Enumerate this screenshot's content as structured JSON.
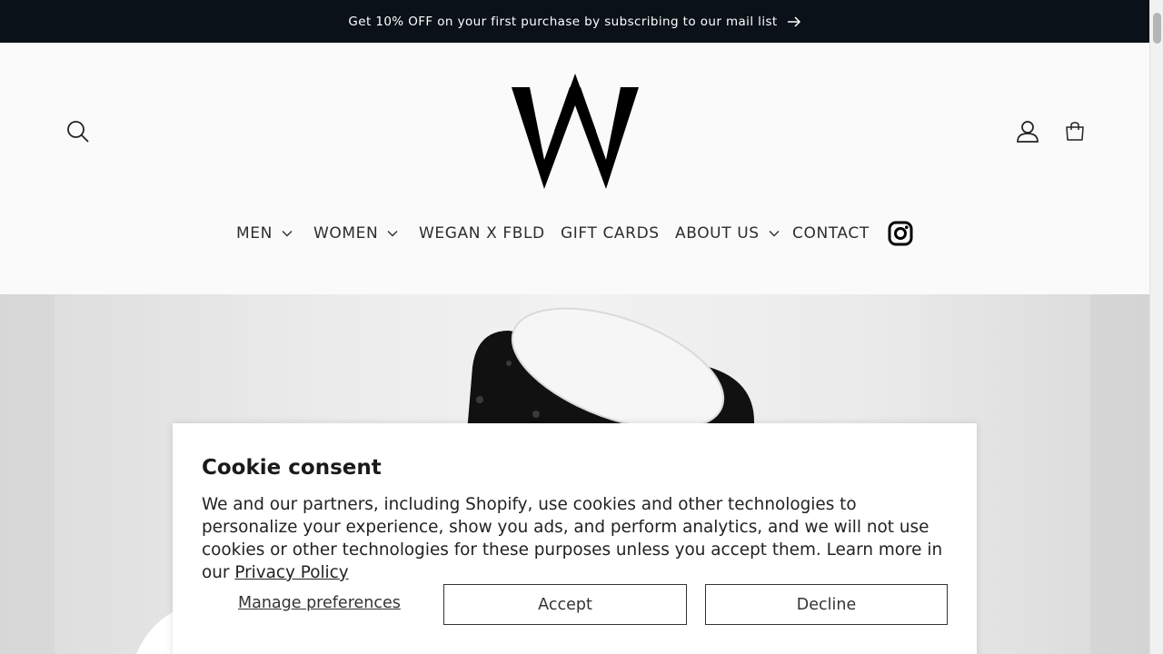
{
  "announcement": {
    "text": "Get 10% OFF on your first purchase by subscribing to our mail list"
  },
  "nav": {
    "items": [
      {
        "label": "MEN"
      },
      {
        "label": "WOMEN"
      },
      {
        "label": "WEGAN X FBLD"
      },
      {
        "label": "GIFT CARDS"
      },
      {
        "label": "ABOUT US"
      },
      {
        "label": "CONTACT"
      }
    ]
  },
  "icons": {
    "search": "search-icon",
    "account": "account-icon",
    "cart": "cart-icon",
    "instagram": "instagram-icon",
    "logo": "w-logo"
  },
  "cookie": {
    "title": "Cookie consent",
    "body": "We and our partners, including Shopify, use cookies and other technologies to personalize your experience, show you ads, and perform analytics, and we will not use cookies or other technologies for these purposes unless you accept them. Learn more in our ",
    "privacy_link": "Privacy Policy",
    "manage_label": "Manage preferences",
    "accept_label": "Accept",
    "decline_label": "Decline"
  },
  "colors": {
    "announcement_bg": "#0b1119",
    "page_bg": "#fafafa"
  }
}
